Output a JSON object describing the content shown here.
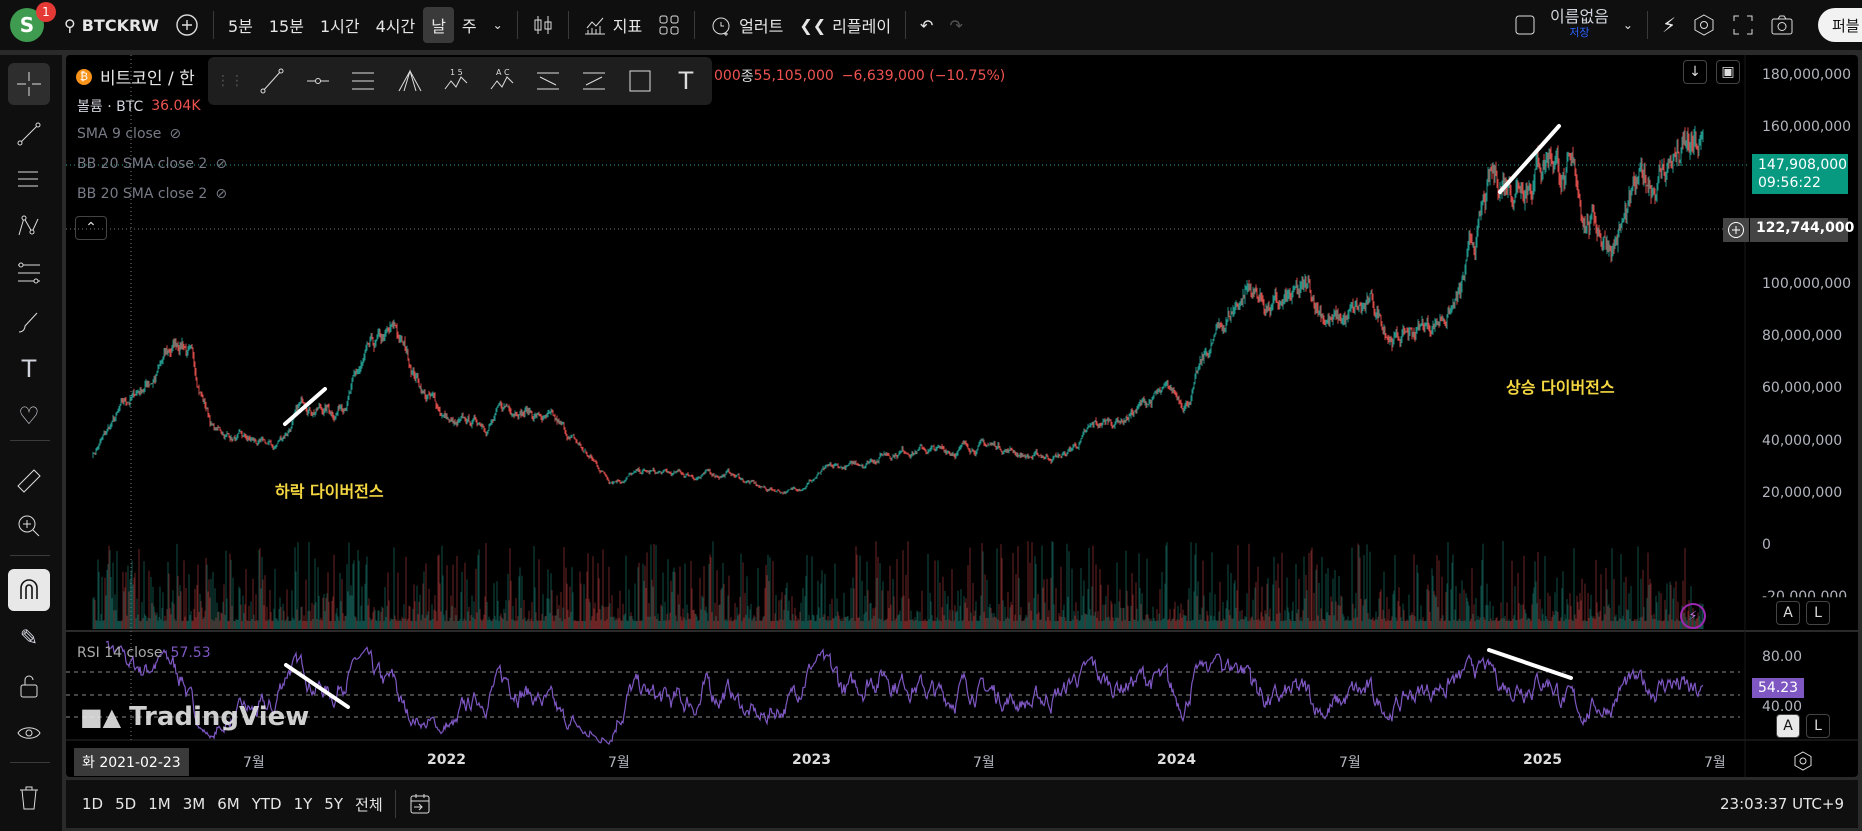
{
  "topbar": {
    "avatar_letter": "S",
    "notification_count": "1",
    "symbol": "BTCKRW",
    "intervals": [
      "5분",
      "15분",
      "1시간",
      "4시간",
      "날",
      "주"
    ],
    "active_interval": "날",
    "indicators_label": "지표",
    "alert_label": "얼러트",
    "replay_label": "리플레이",
    "layout_name": "이름없음",
    "layout_save": "저장",
    "publish_label": "퍼블"
  },
  "legend": {
    "title": "비트코인 / 한",
    "ohlc_fragment": "000",
    "close_label": "종",
    "close_value": "55,105,000",
    "change": "−6,639,000 (−10.75%)",
    "volume_label": "볼륨 · BTC",
    "volume_value": "36.04K",
    "indicators": [
      "SMA 9 close",
      "BB 20 SMA close 2",
      "BB 20 SMA close 2"
    ],
    "rsi_label": "RSI 14 close",
    "rsi_value": "57.53"
  },
  "price_axis": {
    "ticks": [
      "180,000,000",
      "160,000,000",
      "100,000,000",
      "80,000,000",
      "60,000,000",
      "40,000,000",
      "20,000,000",
      "0",
      "-20,000,000"
    ],
    "tick_values": [
      180000000,
      160000000,
      100000000,
      80000000,
      60000000,
      40000000,
      20000000,
      0,
      -20000000
    ],
    "current_price": "147,908,000",
    "countdown": "09:56:22",
    "crosshair_price": "122,744,000"
  },
  "rsi_axis": {
    "ticks": [
      "80.00",
      "40.00"
    ],
    "current": "54.23"
  },
  "time_axis": {
    "labels": [
      "7월",
      "2022",
      "7월",
      "2023",
      "7월",
      "2024",
      "7월",
      "2025",
      "7월"
    ],
    "label_dates": [
      "2021-07-01",
      "2022-01-01",
      "2022-07-01",
      "2023-01-01",
      "2023-07-01",
      "2024-01-01",
      "2024-07-01",
      "2025-01-01",
      "2025-07-01"
    ],
    "crosshair_date": "화 2021-02-23"
  },
  "annotations": {
    "bearish": "하락 다이버전스",
    "bullish": "상승 다이버전스"
  },
  "watermark": "TradingView",
  "bottombar": {
    "ranges": [
      "1D",
      "5D",
      "1M",
      "3M",
      "6M",
      "YTD",
      "1Y",
      "5Y",
      "전체"
    ],
    "clock": "23:03:37 UTC+9"
  },
  "scale_buttons": {
    "auto": "A",
    "log": "L"
  },
  "colors": {
    "up": "#26a69a",
    "down": "#ef5350",
    "rsi": "#7e57c2",
    "annotation": "#f5d742",
    "price_tag": "#089981"
  },
  "price_series_monthly": {
    "start": "2021-01-15",
    "closes_million_krw": [
      35,
      52,
      65,
      80,
      45,
      40,
      37,
      55,
      52,
      70,
      80,
      58,
      45,
      48,
      55,
      48,
      38,
      26,
      28,
      27,
      27,
      28,
      22,
      21,
      28,
      30,
      36,
      38,
      36,
      39,
      38,
      34,
      35,
      45,
      50,
      57,
      56,
      80,
      100,
      90,
      95,
      85,
      90,
      80,
      85,
      95,
      135,
      145,
      155,
      130,
      118,
      135,
      150,
      148
    ]
  }
}
